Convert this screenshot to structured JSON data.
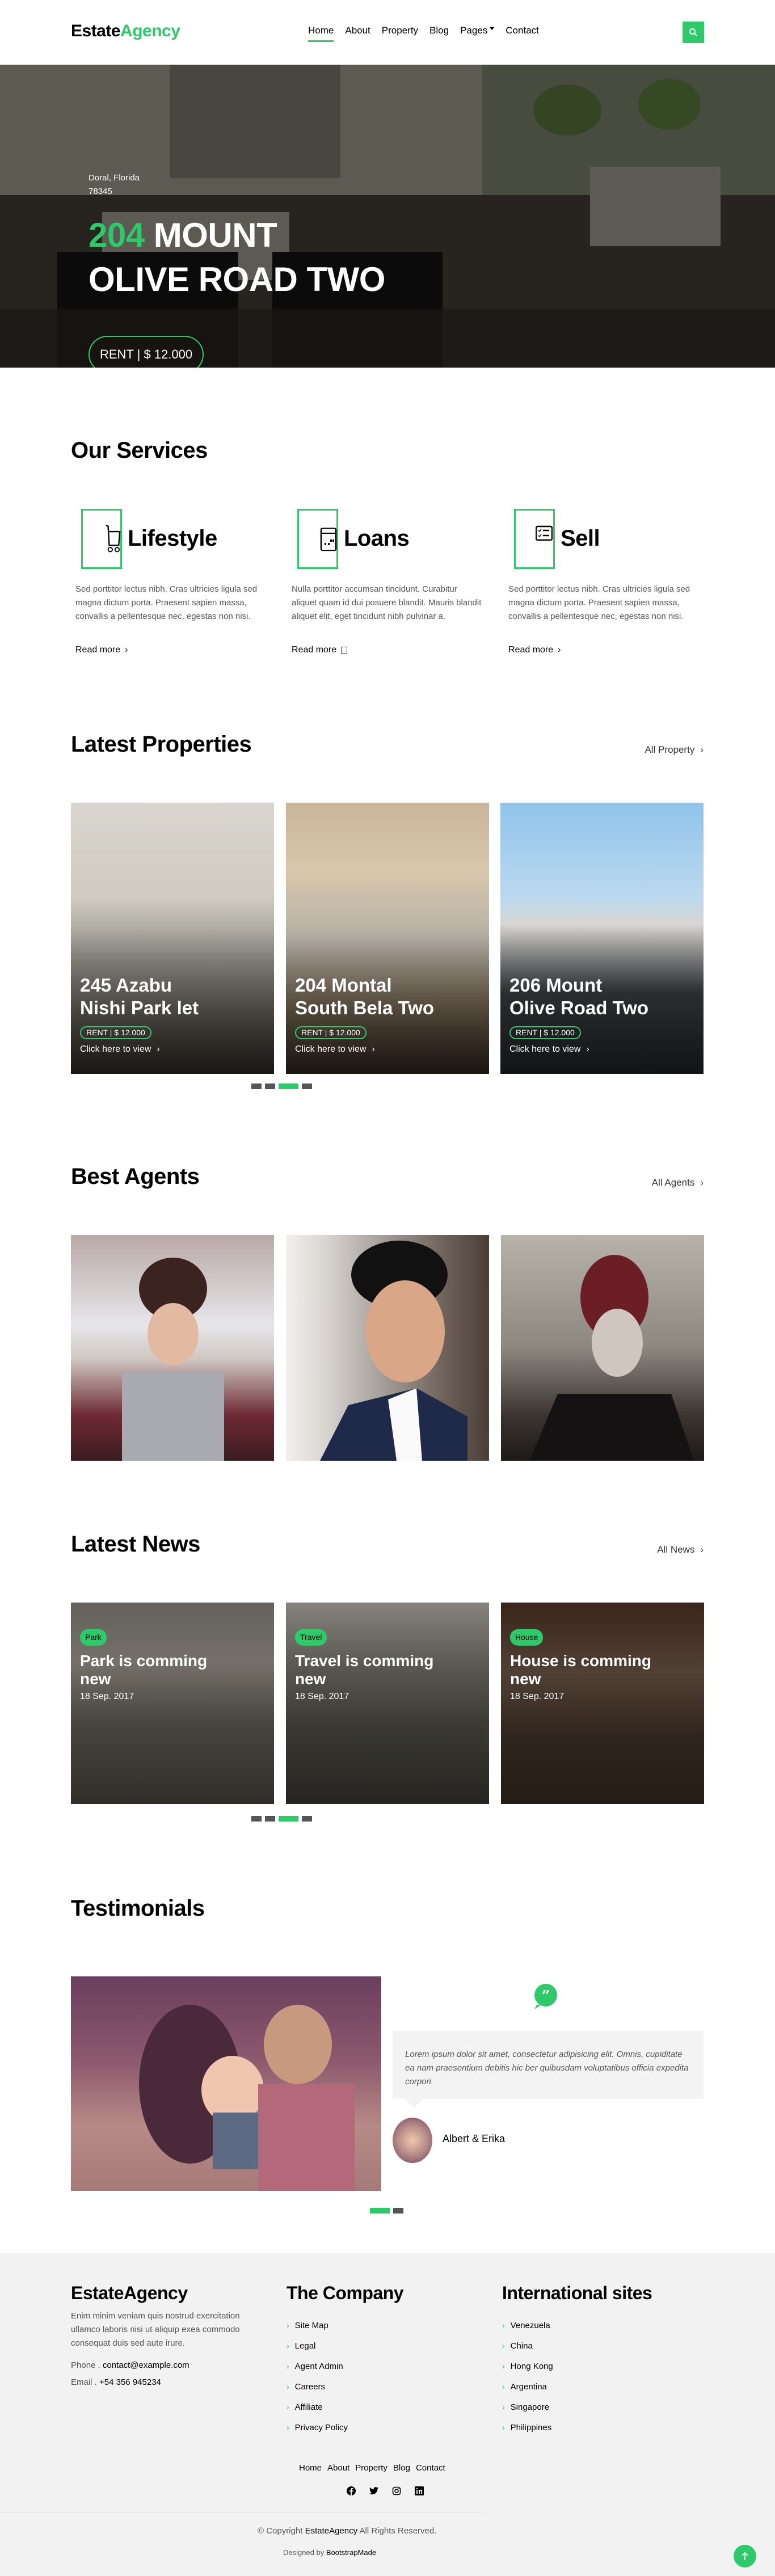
{
  "colors": {
    "accent": "#2eca6a",
    "footer_bg": "#f2f2f2",
    "text_muted": "#555555"
  },
  "navbar": {
    "brand_part1": "Estate",
    "brand_part2": "Agency",
    "links": [
      {
        "label": "Home",
        "active": true
      },
      {
        "label": "About"
      },
      {
        "label": "Property"
      },
      {
        "label": "Blog"
      },
      {
        "label": "Pages",
        "dropdown": true
      },
      {
        "label": "Contact"
      }
    ],
    "search_icon": "search-icon"
  },
  "hero": {
    "location_line1": "Doral, Florida",
    "location_line2": "78345",
    "title_number": "204",
    "title_rest_line1": " MOUNT",
    "title_line2": "OLIVE ROAD TWO",
    "price": "RENT | $ 12.000",
    "slides": 3,
    "active_slide": 1
  },
  "services": {
    "title": "Our Services",
    "items": [
      {
        "icon": "cart-icon",
        "title": "Lifestyle",
        "text": "Sed porttitor lectus nibh. Cras ultricies ligula sed magna dictum porta. Praesent sapien massa, convallis a pellentesque nec, egestas non nisi.",
        "link": "Read more",
        "link_icon": "chevron-right-icon"
      },
      {
        "icon": "calendar-icon",
        "title": "Loans",
        "text": "Nulla porttitor accumsan tincidunt. Curabitur aliquet quam id dui posuere blandit. Mauris blandit aliquet elit, eget tincidunt nibh pulvinar a.",
        "link": "Read more",
        "link_icon": "calendar-icon"
      },
      {
        "icon": "checklist-icon",
        "title": "Sell",
        "text": "Sed porttitor lectus nibh. Cras ultricies ligula sed magna dictum porta. Praesent sapien massa, convallis a pellentesque nec, egestas non nisi.",
        "link": "Read more",
        "link_icon": "chevron-right-icon"
      }
    ]
  },
  "properties": {
    "title": "Latest Properties",
    "all_link": "All Property",
    "cards": [
      {
        "title_line1": "245 Azabu",
        "title_line2": "Nishi Park let",
        "price": "RENT | $ 12.000",
        "view": "Click here to view"
      },
      {
        "title_line1": "204 Montal",
        "title_line2": "South Bela Two",
        "price": "RENT | $ 12.000",
        "view": "Click here to view"
      },
      {
        "title_line1": "206 Mount",
        "title_line2": "Olive Road Two",
        "price": "RENT | $ 12.000",
        "view": "Click here to view"
      }
    ],
    "pages": 4,
    "active_page": 3
  },
  "agents": {
    "title": "Best Agents",
    "all_link": "All Agents",
    "cards": [
      {
        "photo": "agent-photo-1"
      },
      {
        "photo": "agent-photo-2"
      },
      {
        "photo": "agent-photo-3"
      }
    ]
  },
  "news": {
    "title": "Latest News",
    "all_link": "All News",
    "cards": [
      {
        "badge": "Park",
        "title": "Park is comming new",
        "date": "18 Sep. 2017"
      },
      {
        "badge": "Travel",
        "title": "Travel is comming new",
        "date": "18 Sep. 2017"
      },
      {
        "badge": "House",
        "title": "House is comming new",
        "date": "18 Sep. 2017"
      }
    ],
    "pages": 4,
    "active_page": 3
  },
  "testimonials": {
    "title": "Testimonials",
    "quote": "Lorem ipsum dolor sit amet, consectetur adipisicing elit. Omnis, cupiditate ea nam praesentium debitis hic ber quibusdam voluptatibus officia expedita corpori.",
    "author": "Albert & Erika",
    "pages": 2,
    "active_page": 1
  },
  "footer": {
    "brand": "EstateAgency",
    "about": "Enim minim veniam quis nostrud exercitation ullamco laboris nisi ut aliquip exea commodo consequat duis sed aute irure.",
    "phone_label": "Phone .",
    "phone_value": "contact@example.com",
    "email_label": "Email .",
    "email_value": "+54 356 945234",
    "company_title": "The Company",
    "company_links": [
      "Site Map",
      "Legal",
      "Agent Admin",
      "Careers",
      "Affiliate",
      "Privacy Policy"
    ],
    "intl_title": "International sites",
    "intl_links": [
      "Venezuela",
      "China",
      "Hong Kong",
      "Argentina",
      "Singapore",
      "Philippines"
    ],
    "nav": [
      "Home",
      "About",
      "Property",
      "Blog",
      "Contact"
    ],
    "social": [
      "facebook-icon",
      "twitter-icon",
      "instagram-icon",
      "linkedin-icon"
    ],
    "copyright_prefix": "© Copyright",
    "copyright_brand": "EstateAgency",
    "copyright_suffix": "All Rights Reserved.",
    "designed_prefix": "Designed by",
    "designed_by": "BootstrapMade"
  }
}
